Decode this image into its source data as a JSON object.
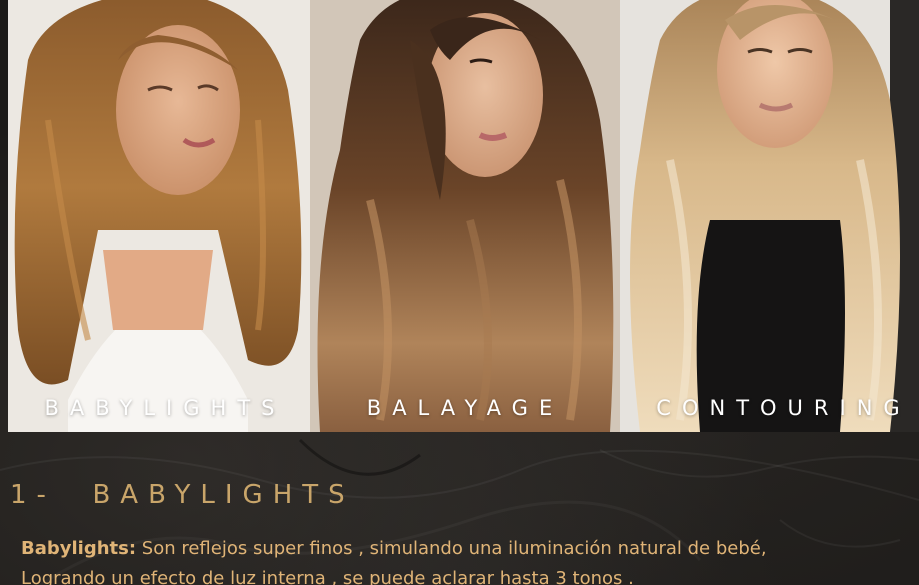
{
  "gallery": {
    "items": [
      {
        "caption": "BABYLIGHTS"
      },
      {
        "caption": "BALAYAGE"
      },
      {
        "caption": "CONTOURING"
      }
    ]
  },
  "section": {
    "number": "1-",
    "title": "BABYLIGHTS",
    "term": "Babylights:",
    "line1": " Son reflejos super finos , simulando una iluminación natural de bebé,",
    "line2": "Logrando un efecto de luz interna , se puede aclarar hasta 3 tonos ."
  },
  "colors": {
    "background": "#1c1a18",
    "accent_gold": "#c9a56a",
    "text_gold": "#e0b477",
    "caption_white": "#ffffff"
  }
}
